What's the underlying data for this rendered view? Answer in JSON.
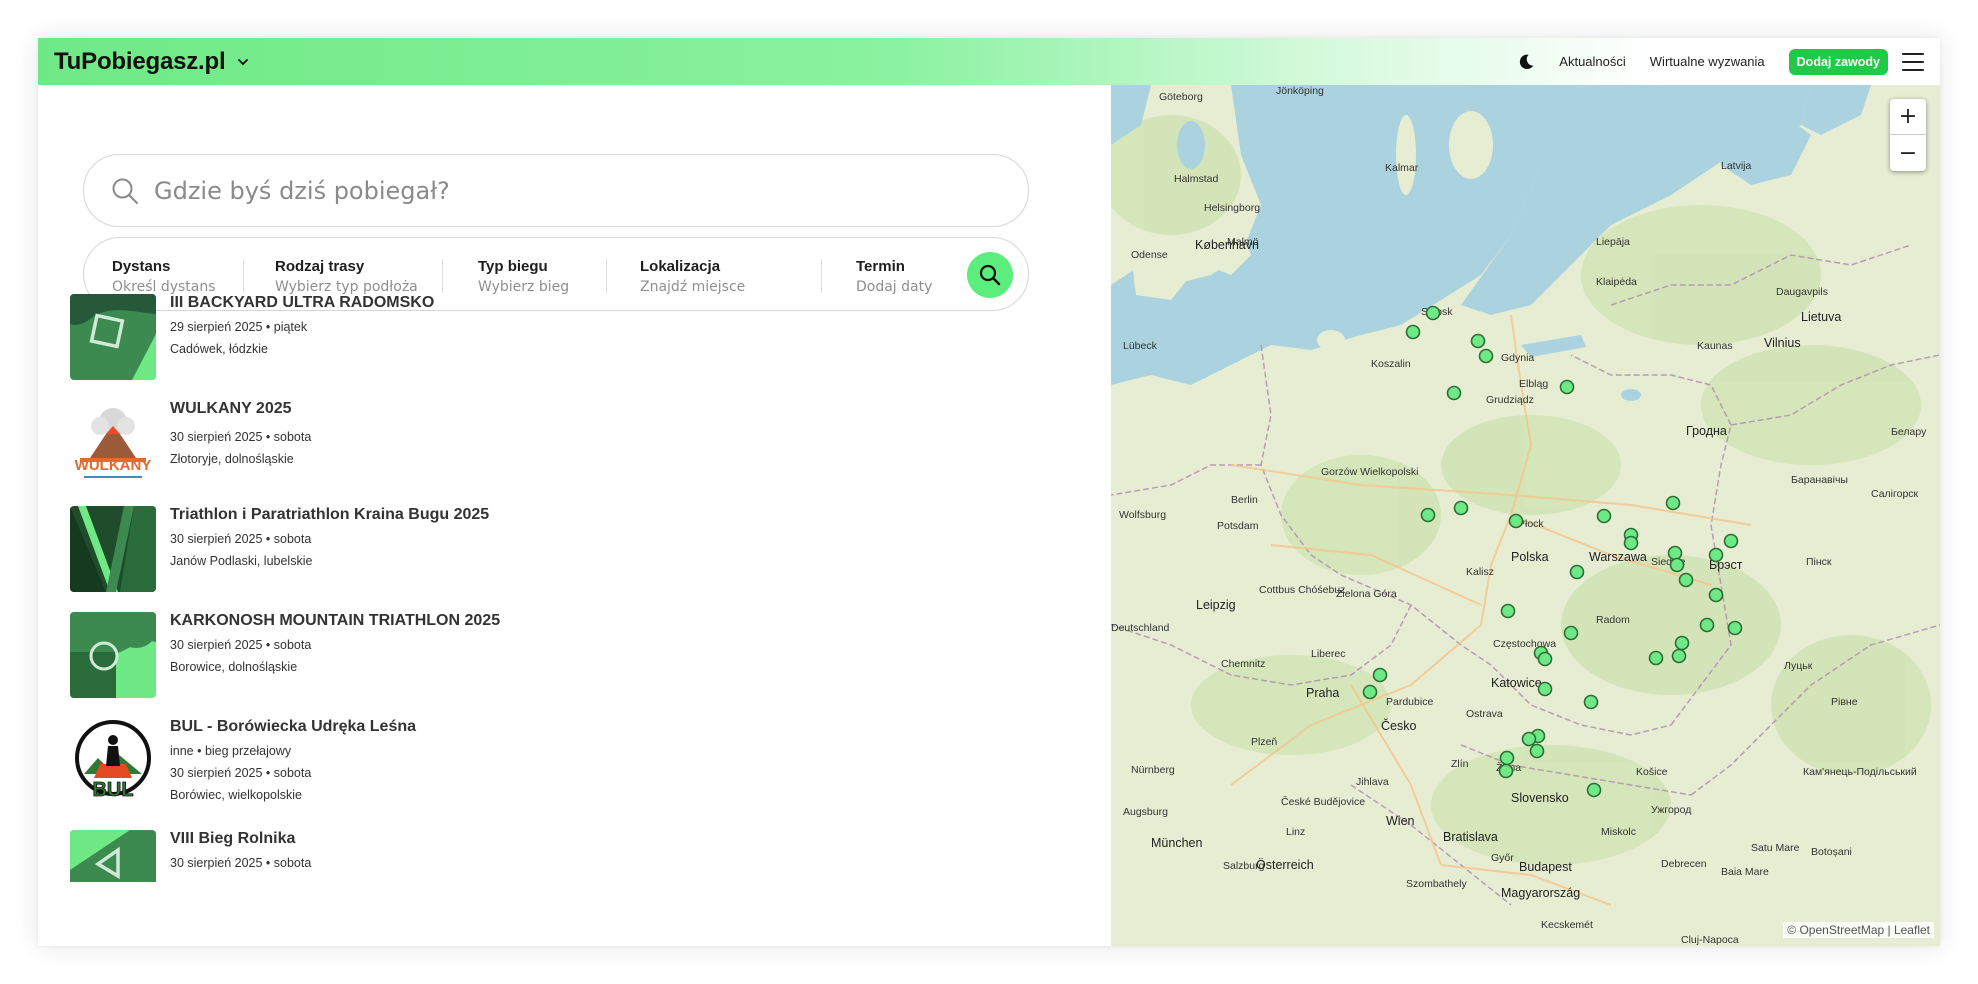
{
  "header": {
    "logo": "TuPobiegasz.pl",
    "nav_links": [
      "Aktualności",
      "Wirtualne wyzwania"
    ],
    "add_button": "Dodaj zawody",
    "theme_icon": "moon-icon",
    "menu_icon": "hamburger-icon",
    "brand_color": "#6fe985"
  },
  "search": {
    "placeholder": "Gdzie byś dziś pobiegał?"
  },
  "filters": [
    {
      "label": "Dystans",
      "value": "Określ dystans"
    },
    {
      "label": "Rodzaj trasy",
      "value": "Wybierz typ podłoża"
    },
    {
      "label": "Typ biegu",
      "value": "Wybierz bieg"
    },
    {
      "label": "Lokalizacja",
      "value": "Znajdź miejsce"
    },
    {
      "label": "Termin",
      "value": "Dodaj daty"
    }
  ],
  "events": [
    {
      "title": "III BACKYARD ULTRA RADOMSKO",
      "category": "",
      "date": "29 sierpień 2025 • piątek",
      "location": "Cadówek, łódzkie"
    },
    {
      "title": "WULKANY 2025",
      "category": "",
      "date": "30 sierpień 2025 • sobota",
      "location": "Złotoryje, dolnośląskie"
    },
    {
      "title": "Triathlon i Paratriathlon Kraina Bugu 2025",
      "category": "",
      "date": "30 sierpień 2025 • sobota",
      "location": "Janów Podlaski, lubelskie"
    },
    {
      "title": "KARKONOSH MOUNTAIN TRIATHLON 2025",
      "category": "",
      "date": "30 sierpień 2025 • sobota",
      "location": "Borowice, dolnośląskie"
    },
    {
      "title": "BUL - Borówiecka Udręka Leśna",
      "category": "inne • bieg przełajowy",
      "date": "30 sierpień 2025 • sobota",
      "location": "Borówiec, wielkopolskie"
    },
    {
      "title": "VIII Bieg Rolnika",
      "category": "",
      "date": "30 sierpień 2025 • sobota",
      "location": ""
    }
  ],
  "thumb_texts": {
    "wulkany": "WULKANY",
    "bul": "BUL"
  },
  "map": {
    "zoom_in": "+",
    "zoom_out": "−",
    "attribution": "© OpenStreetMap | Leaflet",
    "marker_color": "#6fe985",
    "labels": {
      "goteborg": "Göteborg",
      "jonkoping": "Jönköping",
      "kobenhavn": "København",
      "malmo": "Malmö",
      "helsingborg": "Helsingborg",
      "halmstad": "Halmstad",
      "kalmar": "Kalmar",
      "odense": "Odense",
      "lubeck": "Lübeck",
      "berlin": "Berlin",
      "potsdam": "Potsdam",
      "leipzig": "Leipzig",
      "chemnitz": "Chemnitz",
      "praha": "Praha",
      "plzen": "Plzeň",
      "pardubice": "Pardubice",
      "nurnberg": "Nürnberg",
      "wien": "Wien",
      "bratislava": "Bratislava",
      "budapest": "Budapest",
      "munchen": "München",
      "salzburg": "Salzburg",
      "cesko": "Česko",
      "osterreich": "Österreich",
      "slovensko": "Slovensko",
      "magyarorszag": "Magyarország",
      "polska": "Polska",
      "warszawa": "Warszawa",
      "gdynia": "Gdynia",
      "slupsk": "Słupsk",
      "koszalin": "Koszalin",
      "elblag": "Elbląg",
      "grudziadz": "Grudziądz",
      "gorzow": "Gorzów Wielkopolski",
      "plock": "Płock",
      "kalisz": "Kalisz",
      "zielona": "Zielona Góra",
      "cottbus": "Cottbus Chóśebuz",
      "liberec": "Liberec",
      "czestochowa": "Częstochowa",
      "katowice": "Katowice",
      "radom": "Radom",
      "siedlce": "Siedlce",
      "ostrava": "Ostrava",
      "zilina": "Žilina",
      "kosice": "Košice",
      "miskolc": "Miskolc",
      "debrecen": "Debrecen",
      "riga": "Latvija",
      "lietuva": "Lietuva",
      "kaunas": "Kaunas",
      "vilnius": "Vilnius",
      "grodno": "Гродна",
      "brest": "Брэст",
      "lutsk": "Луцьк",
      "rivne": "Рівне",
      "liepaja": "Liepāja",
      "klaipeda": "Klaipėda",
      "daugavpils": "Daugavpils",
      "uzhhorod": "Ужгород",
      "cluj": "Cluj-Napoca",
      "baia": "Baia Mare",
      "botosani": "Botoșani",
      "deutschland": "Deutschland",
      "wolfsburg": "Wolfsburg",
      "augsburg": "Augsburg",
      "jihlava": "Jihlava",
      "zlin": "Zlín",
      "kecskemet": "Kecskemét",
      "szombathely": "Szombathely",
      "gyor": "Győr",
      "linz": "Linz",
      "satu": "Satu Mare",
      "baranavichy": "Баранавічы",
      "salihorsk": "Салігорск",
      "pinsk": "Пінск",
      "kamianets": "Кам'янець-Подільський",
      "belarus": "Белару",
      "usti": "České Budějovice"
    }
  }
}
